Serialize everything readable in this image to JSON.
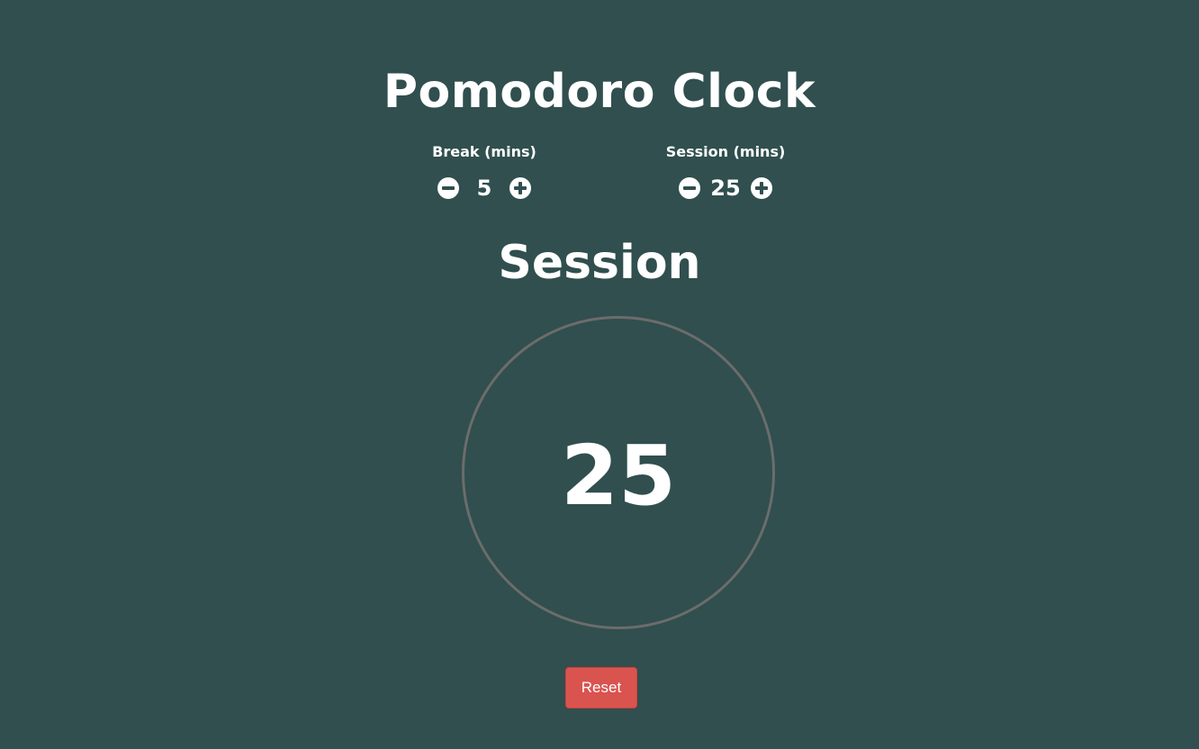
{
  "app": {
    "title": "Pomodoro Clock"
  },
  "break_control": {
    "label": "Break (mins)",
    "value": "5",
    "decrement_icon": "minus-circle-icon",
    "increment_icon": "plus-circle-icon"
  },
  "session_control": {
    "label": "Session (mins)",
    "value": "25",
    "decrement_icon": "minus-circle-icon",
    "increment_icon": "plus-circle-icon"
  },
  "timer": {
    "mode": "Session",
    "display": "25"
  },
  "actions": {
    "reset_label": "Reset"
  },
  "colors": {
    "background": "#304f4e",
    "text": "#ffffff",
    "ring": "#6c6c6c",
    "reset_button": "#d9534f"
  }
}
